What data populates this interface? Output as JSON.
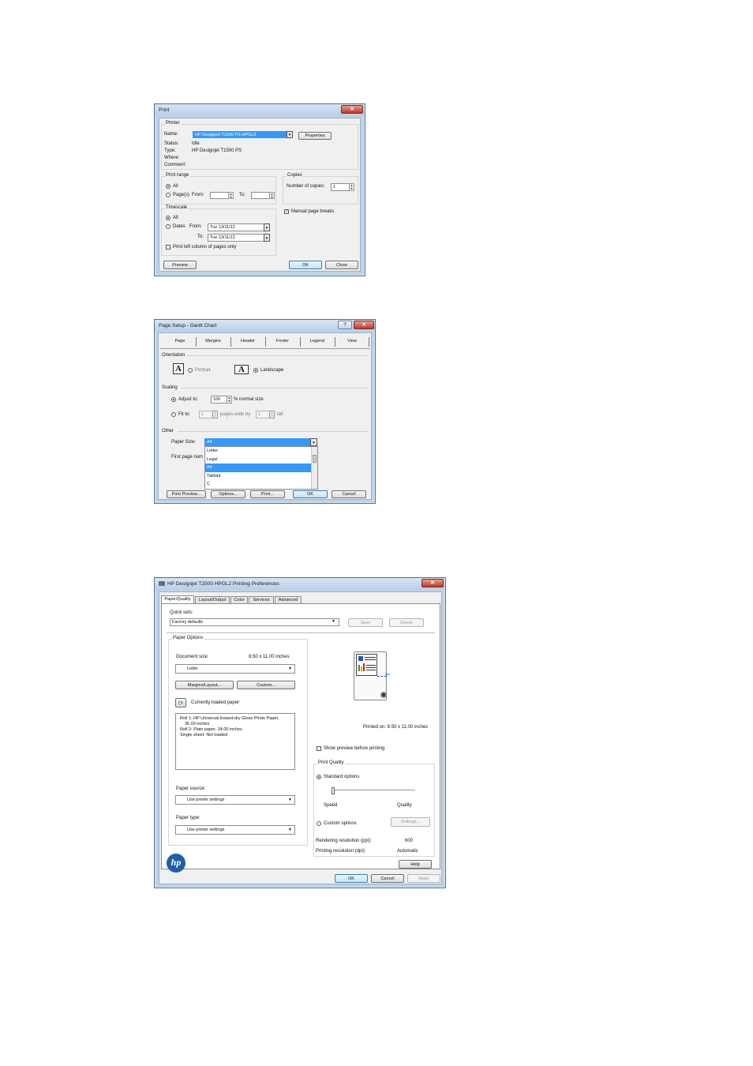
{
  "print_dialog": {
    "title": "Print",
    "printer_group": "Printer",
    "name_label": "Name:",
    "name_value": "HP Designjet T1500 PS HPGL2",
    "properties_button": "Properties",
    "status_label": "Status:",
    "status_value": "Idle",
    "type_label": "Type:",
    "type_value": "HP Designjet T1500 PS",
    "where_label": "Where:",
    "comment_label": "Comment:",
    "print_range_group": "Print range",
    "all_label": "All",
    "pages_label": "Page(s)",
    "from_label": "From:",
    "to_label": "To:",
    "copies_group": "Copies",
    "copies_label": "Number of copies:",
    "copies_value": "1",
    "timescale_group": "Timescale",
    "ts_all_label": "All",
    "dates_label": "Dates",
    "ts_from_label": "From:",
    "ts_from_value": "Tue 13/11/12",
    "ts_to_label": "To:",
    "ts_to_value": "Tue 13/11/12",
    "manual_breaks_label": "Manual page breaks",
    "left_column_label": "Print left column of pages only",
    "preview_button": "Preview",
    "ok_button": "OK",
    "close_button": "Close"
  },
  "page_setup": {
    "title": "Page Setup - Gantt Chart",
    "tabs": [
      "Page",
      "Margins",
      "Header",
      "Footer",
      "Legend",
      "View"
    ],
    "orientation_group": "Orientation",
    "portrait_label": "Portrait",
    "landscape_label": "Landscape",
    "orientation_glyph": "A",
    "scaling_group": "Scaling",
    "adjust_label": "Adjust to:",
    "adjust_value": "100",
    "normal_size_label": "% normal size",
    "fit_label": "Fit to:",
    "fit_wide_value": "1",
    "pages_wide_label": "pages wide by",
    "fit_tall_value": "1",
    "tall_label": "tall",
    "other_group": "Other",
    "paper_size_label": "Paper Size:",
    "paper_size_value": "A4",
    "paper_options": [
      "Letter",
      "Legal",
      "A4",
      "Tabloid",
      "C"
    ],
    "first_page_label": "First page num",
    "print_preview_button": "Print Preview...",
    "options_button": "Options...",
    "print_button": "Print...",
    "ok_button": "OK",
    "cancel_button": "Cancel",
    "help_glyph": "?"
  },
  "preferences": {
    "title": "HP Designjet T2500 HPGL2 Printing Preferences",
    "tabs": [
      "Paper/Quality",
      "Layout/Output",
      "Color",
      "Services",
      "Advanced"
    ],
    "quick_sets_label": "Quick sets:",
    "quick_sets_value": "Factory defaults",
    "save_button": "Save",
    "delete_button": "Delete",
    "paper_options_group": "Paper Options",
    "document_size_label": "Document size:",
    "document_size_value": "8.50 x 11.00 inches",
    "document_size_select": "Letter",
    "margins_button": "Margins/Layout...",
    "custom_button": "Custom...",
    "loaded_paper_label": "Currently loaded paper:",
    "loaded_paper_lines": [
      "Roll 1: HP Universal Instant-dry Gloss Photo Paper,",
      "36.00 inches",
      "Roll 2: Plain paper, 24.00 inches",
      "Single sheet: Not loaded"
    ],
    "paper_source_label": "Paper source:",
    "paper_source_value": "Use printer settings",
    "paper_type_label": "Paper type:",
    "paper_type_value": "Use printer settings",
    "printed_on": "Printed on: 8.50 x 11.00 inches",
    "show_preview_label": "Show preview before printing",
    "print_quality_group": "Print Quality",
    "standard_options_label": "Standard options",
    "speed_label": "Speed",
    "quality_label": "Quality",
    "speed_quality_level": 0,
    "custom_options_label": "Custom options",
    "settings_button": "Settings...",
    "rendering_label": "Rendering resolution (ppi):",
    "rendering_value": "600",
    "printing_res_label": "Printing resolution (dpi):",
    "printing_res_value": "Automatic",
    "hp_logo": "hp",
    "help_button": "Help",
    "ok_button": "OK",
    "cancel_button": "Cancel",
    "apply_button": "Apply"
  }
}
